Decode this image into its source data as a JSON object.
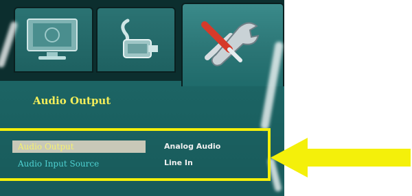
{
  "tabs": [
    {
      "icon": "monitor-icon"
    },
    {
      "icon": "connector-icon"
    },
    {
      "icon": "tools-icon"
    }
  ],
  "menu": {
    "section_title": "Audio Output",
    "rows": [
      {
        "label": "Audio Output",
        "value": "Analog Audio",
        "selected": true
      },
      {
        "label": "Audio Input Source",
        "value": "Line In",
        "selected": false
      }
    ]
  },
  "annotation": {
    "highlight_color": "#f4f00a",
    "arrow_color": "#f4f00a"
  }
}
